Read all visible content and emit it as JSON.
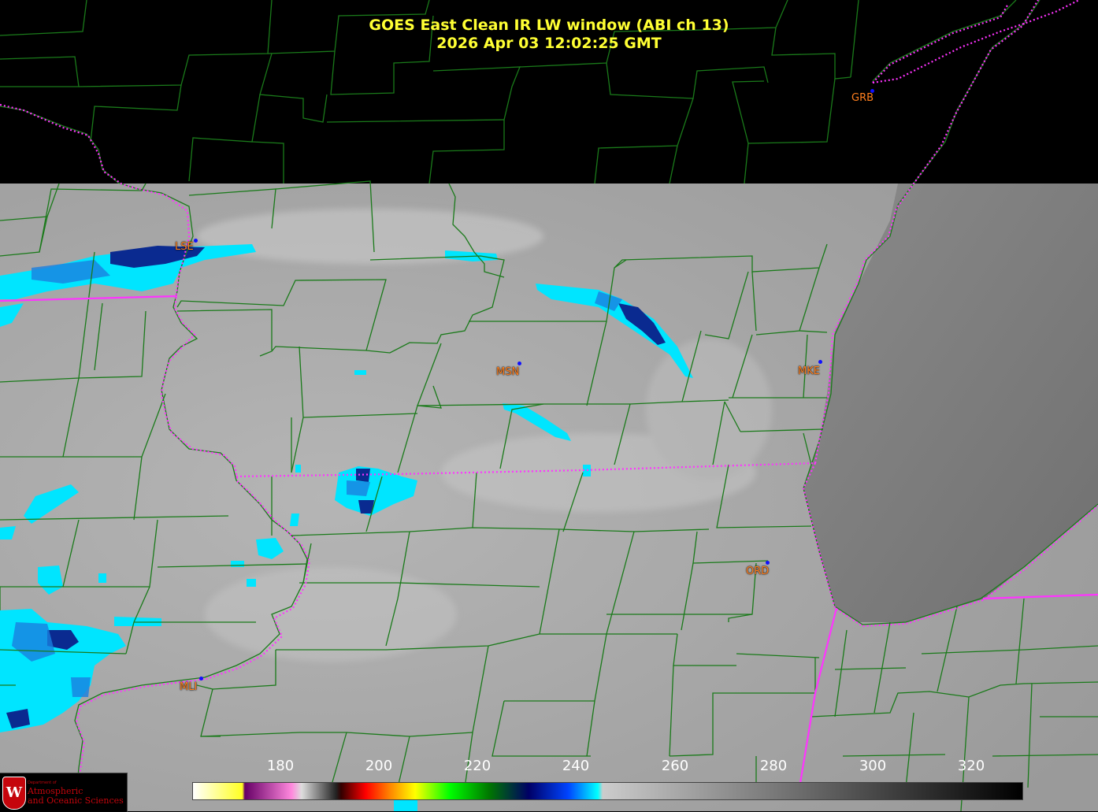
{
  "title": {
    "line1": "GOES East Clean IR LW window (ABI ch 13)",
    "line2": "2026 Apr 03  12:02:25 GMT"
  },
  "cities": [
    {
      "code": "GRB"
    },
    {
      "code": "LSE"
    },
    {
      "code": "MSN"
    },
    {
      "code": "MKE"
    },
    {
      "code": "ORD"
    },
    {
      "code": "MLI"
    }
  ],
  "colorbar": {
    "ticks": [
      "180",
      "200",
      "220",
      "240",
      "260",
      "280",
      "300",
      "320"
    ],
    "range": [
      170,
      338
    ],
    "stops": [
      {
        "v": 170,
        "c": "#ffffff"
      },
      {
        "v": 180,
        "c": "#ffff22"
      },
      {
        "v": 180.5,
        "c": "#660066"
      },
      {
        "v": 190,
        "c": "#ff88dd"
      },
      {
        "v": 192,
        "c": "#dddddd"
      },
      {
        "v": 199,
        "c": "#222222"
      },
      {
        "v": 200,
        "c": "#330000"
      },
      {
        "v": 205,
        "c": "#ff0000"
      },
      {
        "v": 210,
        "c": "#ff8800"
      },
      {
        "v": 215,
        "c": "#ffff00"
      },
      {
        "v": 222,
        "c": "#00ff00"
      },
      {
        "v": 230,
        "c": "#007700"
      },
      {
        "v": 238,
        "c": "#000066"
      },
      {
        "v": 246,
        "c": "#0044ff"
      },
      {
        "v": 252,
        "c": "#00ffff"
      },
      {
        "v": 253,
        "c": "#cccccc"
      },
      {
        "v": 338,
        "c": "#000000"
      }
    ]
  },
  "colors": {
    "county_lines": "#1a7a1a",
    "state_lines": "#ff33ff",
    "title": "#ffff33",
    "city_label": "#ff7f1e",
    "city_dot": "#1010ff"
  },
  "logo": {
    "department": "Department of",
    "name_line1": "Atmospheric",
    "name_line2": "and Oceanic Sciences",
    "emblem_letter": "W"
  }
}
